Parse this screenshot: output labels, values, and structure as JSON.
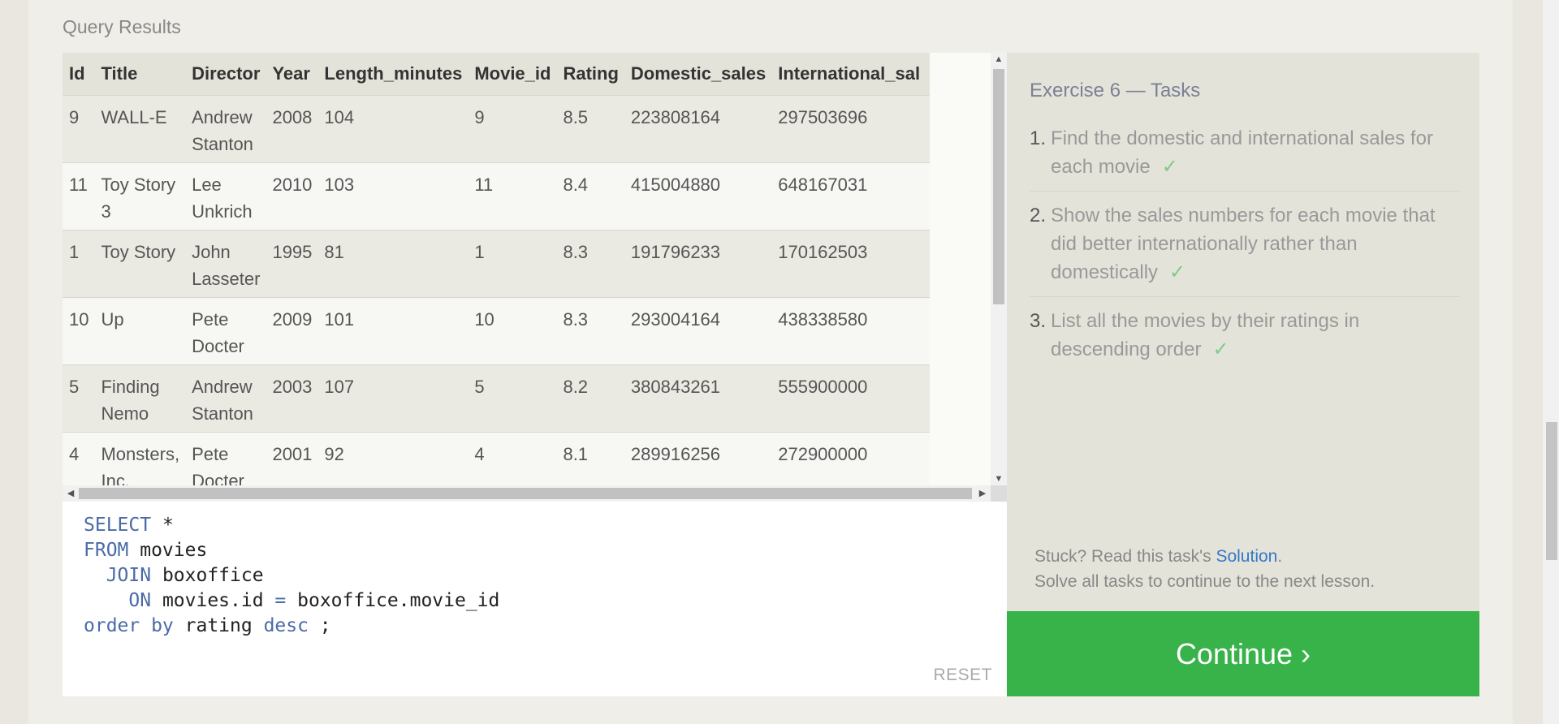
{
  "results": {
    "title": "Query Results",
    "columns": [
      "Id",
      "Title",
      "Director",
      "Year",
      "Length_minutes",
      "Movie_id",
      "Rating",
      "Domestic_sales",
      "International_sal"
    ],
    "rows": [
      [
        "9",
        "WALL-E",
        "Andrew Stanton",
        "2008",
        "104",
        "9",
        "8.5",
        "223808164",
        "297503696"
      ],
      [
        "11",
        "Toy Story 3",
        "Lee Unkrich",
        "2010",
        "103",
        "11",
        "8.4",
        "415004880",
        "648167031"
      ],
      [
        "1",
        "Toy Story",
        "John Lasseter",
        "1995",
        "81",
        "1",
        "8.3",
        "191796233",
        "170162503"
      ],
      [
        "10",
        "Up",
        "Pete Docter",
        "2009",
        "101",
        "10",
        "8.3",
        "293004164",
        "438338580"
      ],
      [
        "5",
        "Finding Nemo",
        "Andrew Stanton",
        "2003",
        "107",
        "5",
        "8.2",
        "380843261",
        "555900000"
      ],
      [
        "4",
        "Monsters, Inc.",
        "Pete Docter",
        "2001",
        "92",
        "4",
        "8.1",
        "289916256",
        "272900000"
      ]
    ]
  },
  "editor": {
    "line1_kw": "SELECT",
    "line1_rest": " *",
    "line2_kw": "FROM",
    "line2_rest": " movies",
    "line3_kw": "JOIN",
    "line3_rest": " boxoffice",
    "line4_kw": "ON",
    "line4_rest1": " movies.id ",
    "line4_eq": "=",
    "line4_rest2": " boxoffice.movie_id",
    "line5_kw1": "order by",
    "line5_rest": " rating ",
    "line5_kw2": "desc",
    "line5_end": " ;",
    "reset_label": "RESET"
  },
  "tasks": {
    "title": "Exercise 6 — Tasks",
    "items": [
      {
        "num": "1.",
        "text": "Find the domestic and international sales for each movie",
        "check": "✓"
      },
      {
        "num": "2.",
        "text": "Show the sales numbers for each movie that did better internationally rather than domestically",
        "check": "✓"
      },
      {
        "num": "3.",
        "text": "List all the movies by their ratings in descending order",
        "check": "✓"
      }
    ],
    "stuck_prefix": "Stuck? Read this task's ",
    "solution_link": "Solution",
    "stuck_suffix": ".",
    "solve_all": "Solve all tasks to continue to the next lesson.",
    "continue_label": "Continue ›"
  },
  "colors": {
    "continue": "#38b34a",
    "keyword": "#4a6ba8",
    "check": "#7ecb86",
    "link": "#3478c6"
  }
}
